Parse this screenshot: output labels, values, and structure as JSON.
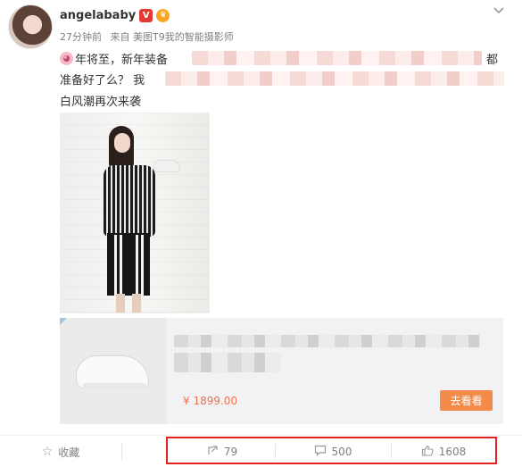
{
  "post": {
    "username": "angelababy",
    "verified_badge": "V",
    "meta_time": "27分钟前",
    "meta_source": "来自 美图T9我的智能摄影师",
    "text_line1": "年将至，新年装备",
    "text_line1_end": "都",
    "text_line2": "准备好了么？ 我",
    "text_line3": "白风潮再次来袭",
    "chevron_icon": "chevron-down-icon",
    "pig_emoji_icon": "pig-emoji-icon"
  },
  "link_card": {
    "price": "¥ 1899.00",
    "button_label": "去看看"
  },
  "footer": {
    "favorite_label": "收藏",
    "forward_count": "79",
    "comment_count": "500",
    "like_count": "1608"
  },
  "colors": {
    "price": "#eb7350",
    "button": "#f48b48",
    "highlight_box": "#e0231e",
    "verified": "#e6392f"
  }
}
